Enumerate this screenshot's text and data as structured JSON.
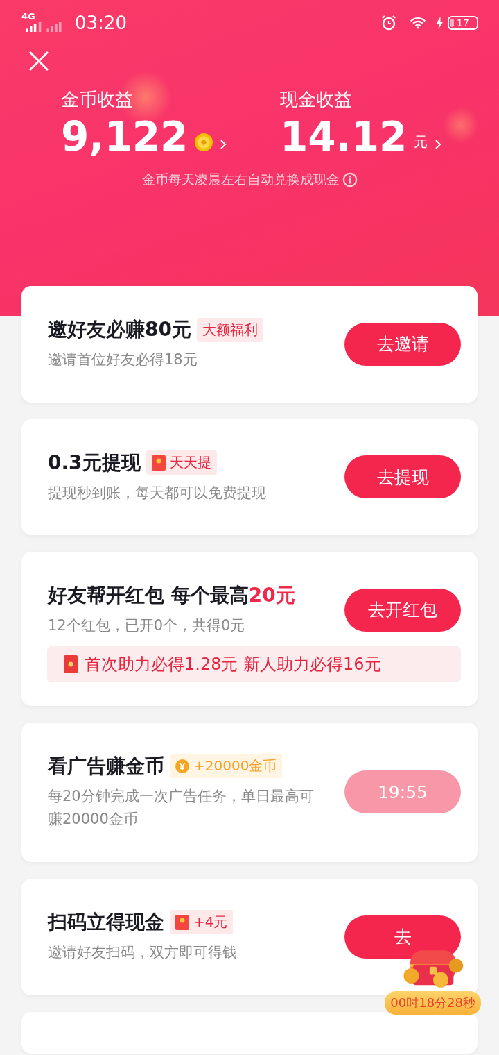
{
  "status_bar": {
    "network": "4G",
    "time": "03:20",
    "battery": "17"
  },
  "header": {
    "stats": [
      {
        "label": "金币收益",
        "value": "9,122",
        "kind": "coin"
      },
      {
        "label": "现金收益",
        "value": "14.12",
        "kind": "text",
        "unit": "元"
      }
    ],
    "note": "金币每天凌晨左右自动兑换成现金"
  },
  "cards": [
    {
      "title": "邀好友必赚80元",
      "tag": {
        "kind": "plain",
        "text": "大额福利"
      },
      "desc": "邀请首位好友必得18元",
      "button": {
        "label": "去邀请",
        "disabled": false
      }
    },
    {
      "title": "0.3元提现",
      "tag": {
        "kind": "envelope",
        "text": "天天提"
      },
      "desc": "提现秒到账，每天都可以免费提现",
      "button": {
        "label": "去提现",
        "disabled": false
      }
    },
    {
      "title": "好友帮开红包 每个最高",
      "title_highlight": "20元",
      "desc": "12个红包，已开0个，共得0元",
      "button": {
        "label": "去开红包",
        "disabled": false
      },
      "banner": "首次助力必得1.28元 新人助力必得16元"
    },
    {
      "title": "看广告赚金币",
      "tag": {
        "kind": "coin",
        "text": "+20000金币"
      },
      "desc": "每20分钟完成一次广告任务，单日最高可赚20000金币",
      "button": {
        "label": "19:55",
        "disabled": true
      }
    },
    {
      "title": "扫码立得现金",
      "tag": {
        "kind": "envelope",
        "text": "+4元"
      },
      "desc": "邀请好友扫码，双方即可得钱",
      "button": {
        "label": "去",
        "disabled": false
      }
    }
  ],
  "chest": {
    "timer": "00时18分28秒"
  }
}
